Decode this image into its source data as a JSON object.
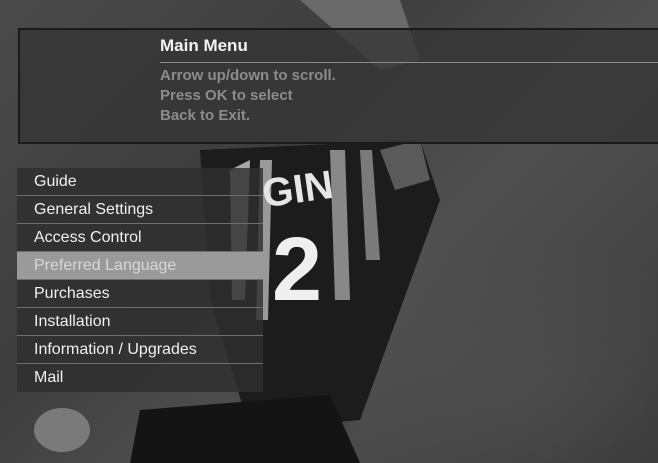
{
  "panel": {
    "title": "Main Menu",
    "lines": [
      "Arrow up/down to scroll.",
      "Press OK to select",
      "Back to Exit."
    ]
  },
  "menu": {
    "items": [
      {
        "label": "Guide",
        "selected": false
      },
      {
        "label": "General Settings",
        "selected": false
      },
      {
        "label": "Access Control",
        "selected": false
      },
      {
        "label": "Preferred Language",
        "selected": true
      },
      {
        "label": "Purchases",
        "selected": false
      },
      {
        "label": "Installation",
        "selected": false
      },
      {
        "label": "Information / Upgrades",
        "selected": false
      },
      {
        "label": "Mail",
        "selected": false
      }
    ]
  },
  "backdrop": {
    "jersey_number": "2",
    "jersey_text": "GIN"
  }
}
